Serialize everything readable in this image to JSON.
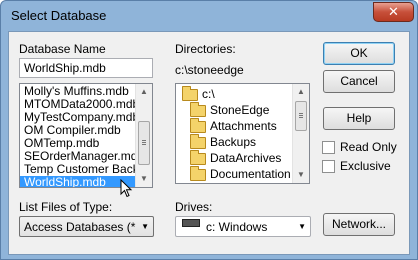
{
  "window": {
    "title": "Select Database",
    "close_glyph": "✕"
  },
  "database_name": {
    "label": "Database Name",
    "value": "WorldShip.mdb",
    "files": [
      "Molly's Muffins.mdb",
      "MTOMData2000.mdb",
      "MyTestCompany.mdb",
      "OM Compiler.mdb",
      "OMTemp.mdb",
      "SEOrderManager.mdb",
      "Temp Customer Backup",
      "WorldShip.mdb"
    ],
    "selected_index": 7
  },
  "directories": {
    "label": "Directories:",
    "current_path": "c:\\stoneedge",
    "tree": [
      "c:\\",
      "StoneEdge",
      "Attachments",
      "Backups",
      "DataArchives",
      "Documentation"
    ]
  },
  "file_type": {
    "label": "List Files of Type:",
    "value": "Access Databases (*.mdb)"
  },
  "drives": {
    "label": "Drives:",
    "value": "c: Windows"
  },
  "buttons": {
    "ok": "OK",
    "cancel": "Cancel",
    "help": "Help",
    "network": "Network..."
  },
  "options": {
    "read_only": "Read Only",
    "exclusive": "Exclusive"
  },
  "icons": {
    "folder": "folder-icon",
    "open_folder": "open-folder-icon",
    "drive": "drive-icon"
  }
}
